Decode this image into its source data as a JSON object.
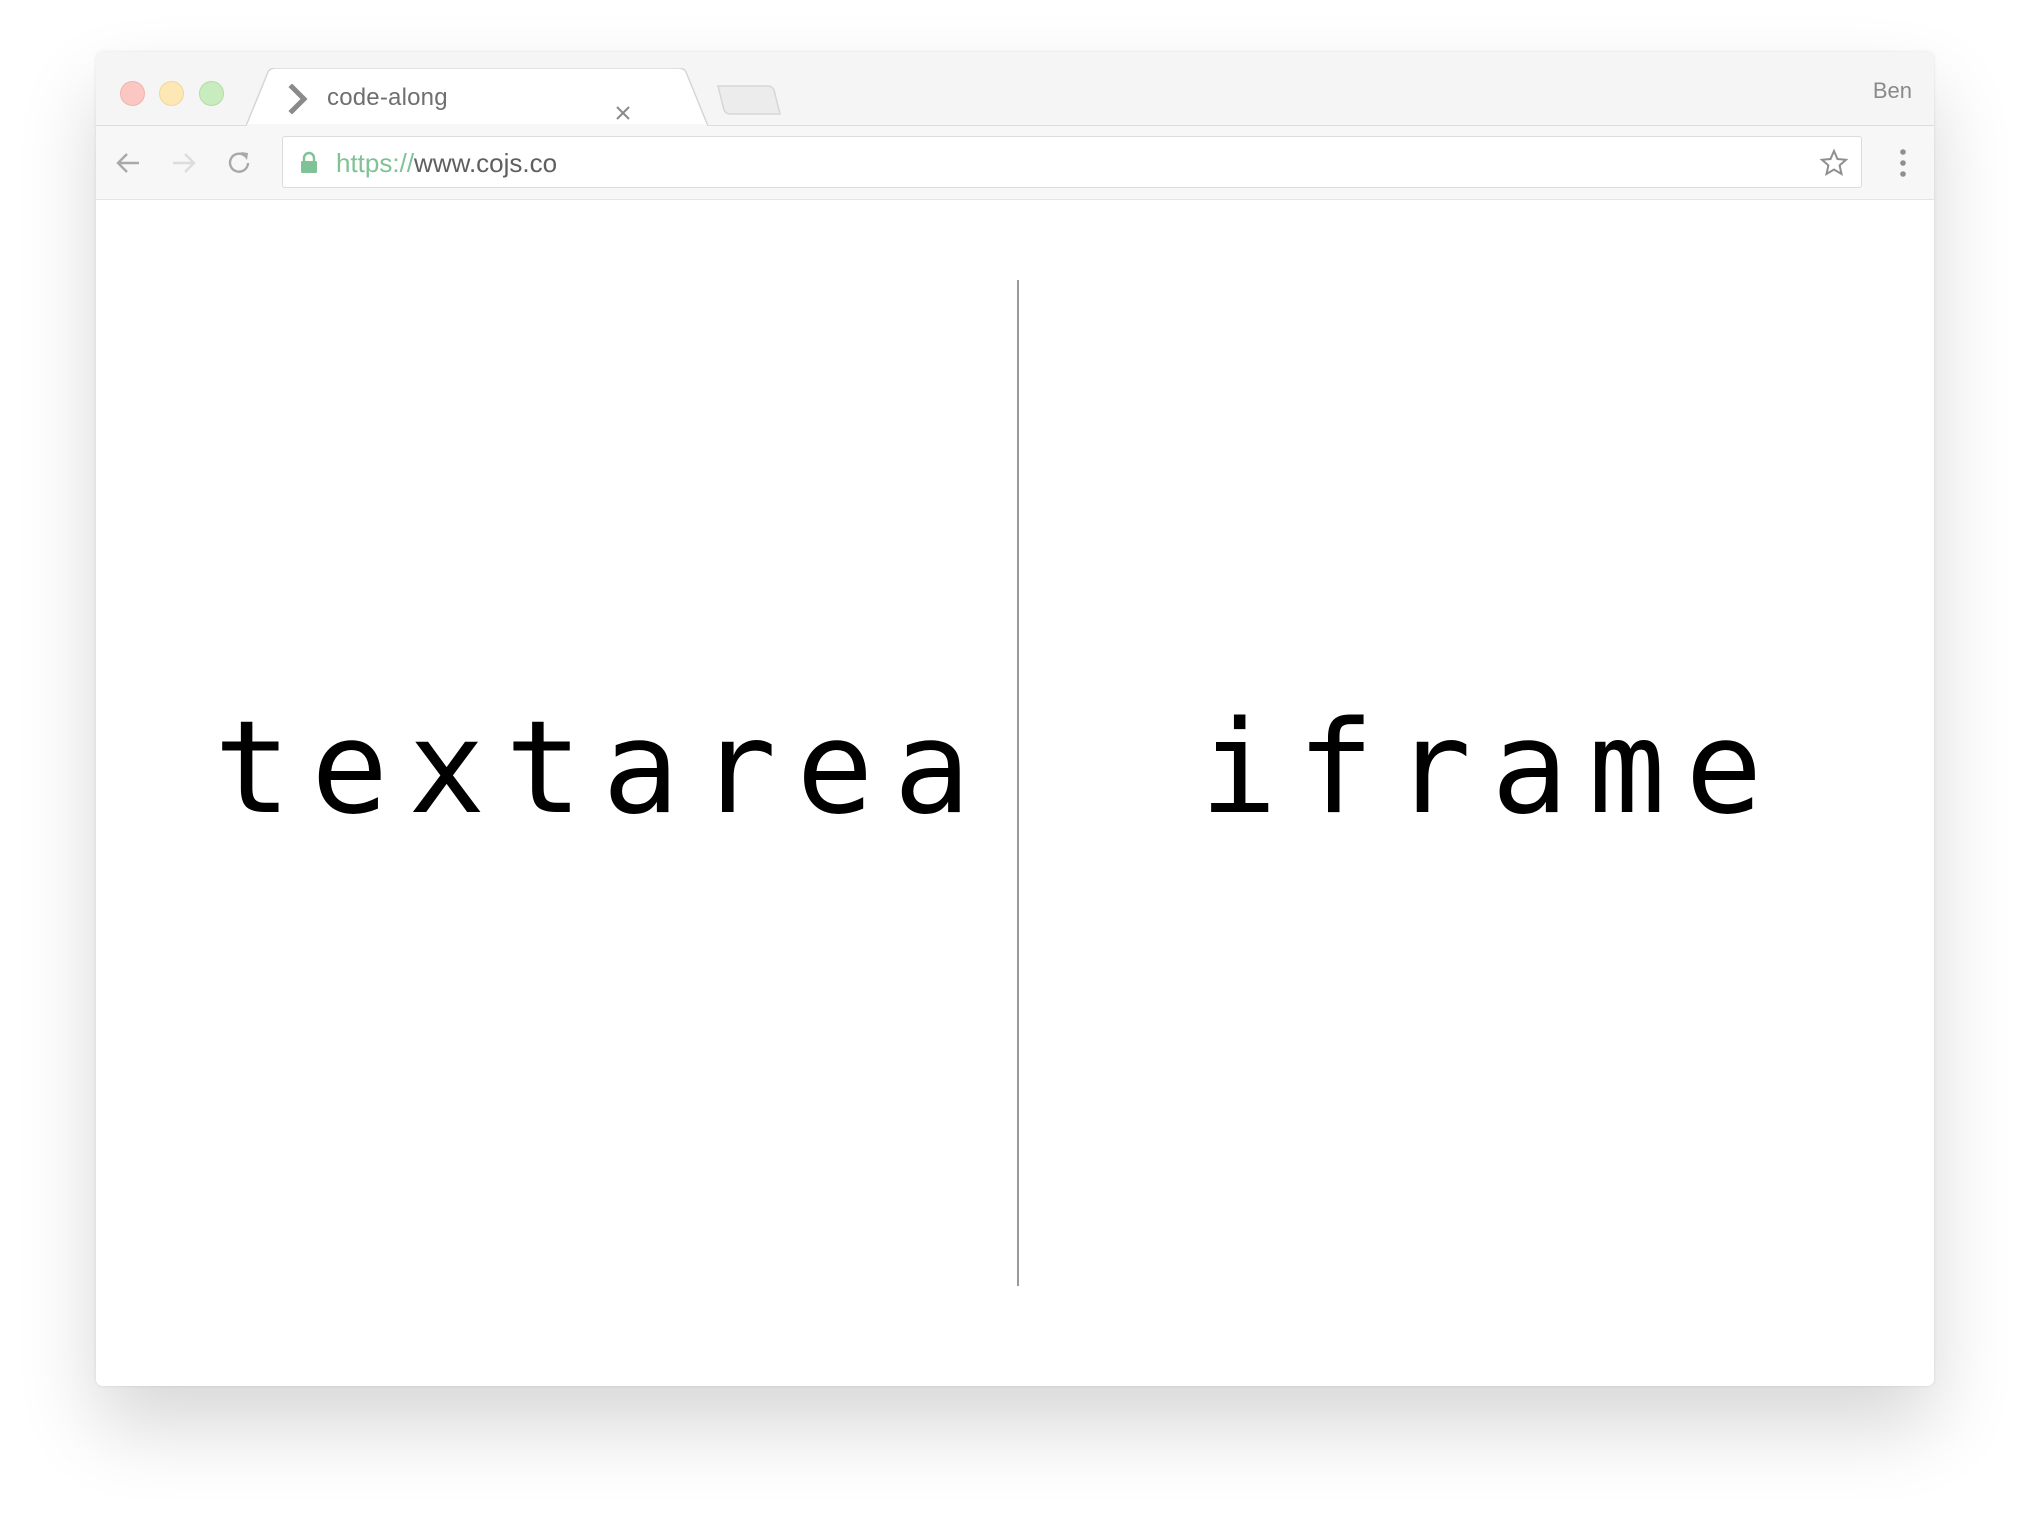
{
  "browser": {
    "tab": {
      "title": "code-along",
      "icon": "chevron-right-icon"
    },
    "profile_name": "Ben",
    "address_bar": {
      "scheme": "https://",
      "host": "www.cojs.co"
    }
  },
  "page": {
    "left_panel_label": "textarea",
    "right_panel_label": "iframe"
  },
  "colors": {
    "secure_scheme": "#7fc296",
    "traffic_red": "#fbc7c2",
    "traffic_yellow": "#fde7b5",
    "traffic_green": "#c8ecbd"
  }
}
